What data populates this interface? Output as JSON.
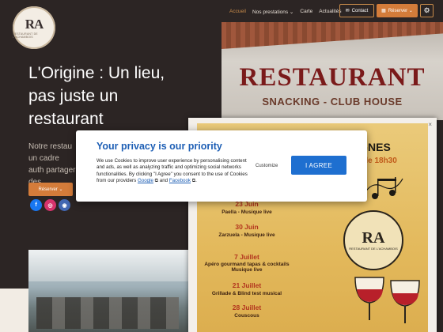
{
  "header": {
    "logo_mark": "RA",
    "logo_sub": "RESTAURANT DE L'ACHAMBOIS",
    "nav": [
      "Accueil",
      "Nos prestations ⌄",
      "Carte",
      "Actualités"
    ],
    "contact_label": "Contact",
    "reserver_label": "Réserver ⌄",
    "settings_icon": "⚙"
  },
  "hero": {
    "sign_main": "RESTAURANT",
    "sign_sub": "SNACKING - CLUB HOUSE",
    "headline": "L'Origine : Un lieu, pas juste un restaurant",
    "description": "Notre restau un cadre auth partager des",
    "button_label": "Réserver ⌄",
    "socials": [
      {
        "name": "facebook-icon",
        "glyph": "f",
        "color": "#1877f2"
      },
      {
        "name": "instagram-icon",
        "glyph": "◎",
        "color": "#d6336c"
      },
      {
        "name": "tripadvisor-icon",
        "glyph": "◉",
        "color": "#4267b2"
      }
    ]
  },
  "poster": {
    "close": "×",
    "title": "AGNES",
    "time": "de 18h30",
    "logo_mark": "RA",
    "logo_sub": "RESTAURANT DE L'ACHAMBOIS",
    "events": [
      {
        "date": "23 Juin",
        "desc": "Paella - Musique live"
      },
      {
        "date": "30 Juin",
        "desc": "Zarzuela - Musique live"
      },
      {
        "date": "7 Juillet",
        "desc": "Apéro gourmand tapas & cocktails Musique live"
      },
      {
        "date": "21 Juillet",
        "desc": "Grillade & Blind test musical"
      },
      {
        "date": "28 Juillet",
        "desc": "Couscous"
      }
    ]
  },
  "privacy": {
    "title": "Your privacy is our priority",
    "text": "We use Cookies to improve user experience by personalising content and ads, as well as analyzing traffic and optimizing social networks functionalities. By clicking \"I Agree\" you consent to the use of Cookies from our providers",
    "link_google": "Google",
    "link_and": "and",
    "link_facebook": "Facebook",
    "customize_label": "Customize",
    "agree_label": "I AGREE"
  }
}
